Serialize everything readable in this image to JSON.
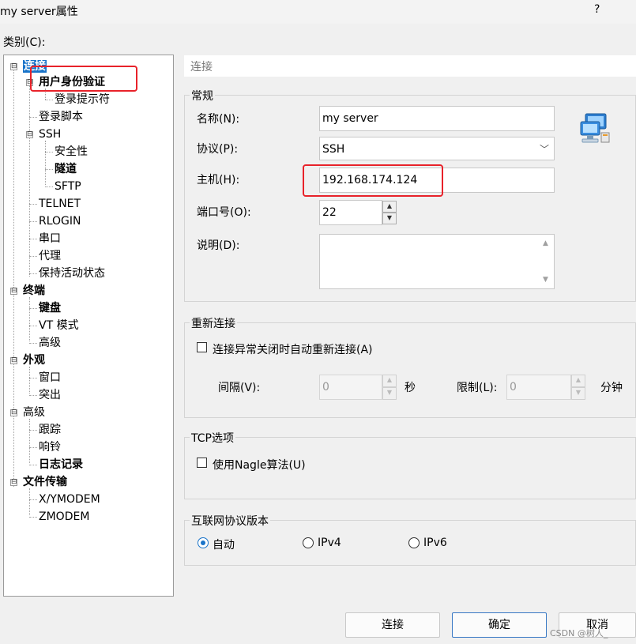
{
  "window": {
    "title": "my server属性",
    "help": "?"
  },
  "category_label": "类别(C):",
  "tree": {
    "items": [
      {
        "label": "连接",
        "bold": true,
        "selected": true
      },
      {
        "label": "用户身份验证",
        "bold": true
      },
      {
        "label": "登录提示符"
      },
      {
        "label": "登录脚本"
      },
      {
        "label": "SSH"
      },
      {
        "label": "安全性"
      },
      {
        "label": "隧道",
        "bold": true
      },
      {
        "label": "SFTP"
      },
      {
        "label": "TELNET"
      },
      {
        "label": "RLOGIN"
      },
      {
        "label": "串口"
      },
      {
        "label": "代理"
      },
      {
        "label": "保持活动状态"
      },
      {
        "label": "终端",
        "bold": true
      },
      {
        "label": "键盘",
        "bold": true
      },
      {
        "label": "VT 模式"
      },
      {
        "label": "高级"
      },
      {
        "label": "外观",
        "bold": true
      },
      {
        "label": "窗口"
      },
      {
        "label": "突出"
      },
      {
        "label": "高级"
      },
      {
        "label": "跟踪"
      },
      {
        "label": "响铃"
      },
      {
        "label": "日志记录",
        "bold": true
      },
      {
        "label": "文件传输",
        "bold": true
      },
      {
        "label": "X/YMODEM"
      },
      {
        "label": "ZMODEM"
      }
    ],
    "expand_sign": "⊟"
  },
  "panel": {
    "header": "连接",
    "general": {
      "title": "常规",
      "name_label": "名称(N):",
      "name_value": "my server",
      "protocol_label": "协议(P):",
      "protocol_value": "SSH",
      "host_label": "主机(H):",
      "host_value": "192.168.174.124",
      "port_label": "端口号(O):",
      "port_value": "22",
      "desc_label": "说明(D):",
      "desc_value": ""
    },
    "reconnect": {
      "title": "重新连接",
      "checkbox_label": "连接异常关闭时自动重新连接(A)",
      "checked": false,
      "interval_label": "间隔(V):",
      "interval_value": "0",
      "interval_unit": "秒",
      "limit_label": "限制(L):",
      "limit_value": "0",
      "limit_unit": "分钟"
    },
    "tcp": {
      "title": "TCP选项",
      "nagle_label": "使用Nagle算法(U)",
      "checked": false
    },
    "ipver": {
      "title": "互联网协议版本",
      "options": [
        "自动",
        "IPv4",
        "IPv6"
      ],
      "selected": "自动"
    }
  },
  "buttons": {
    "connect": "连接",
    "ok": "确定",
    "cancel": "取消"
  },
  "watermark": "CSDN @树人_",
  "colors": {
    "accent": "#1a74c9",
    "highlight_box": "#e8222a"
  }
}
